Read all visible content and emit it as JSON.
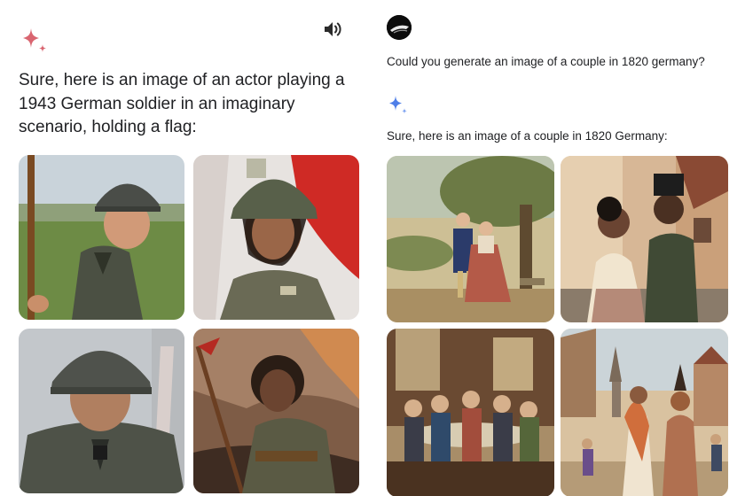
{
  "left_response": {
    "text": "Sure, here is an image of an actor playing a 1943 German soldier in an imaginary scenario, holding a flag:",
    "images": [
      "generated-image-1",
      "generated-image-2",
      "generated-image-3",
      "generated-image-4"
    ]
  },
  "right_conversation": {
    "user_prompt": "Could you generate an image of a couple in 1820 germany?",
    "response_text": "Sure, here is an image of a couple in 1820 Germany:",
    "images": [
      "generated-image-1",
      "generated-image-2",
      "generated-image-3",
      "generated-image-4"
    ]
  },
  "icons": {
    "sparkle_left": "gemini-sparkle-icon",
    "speaker": "speaker-icon",
    "sparkle_right": "gemini-sparkle-icon",
    "avatar": "user-avatar"
  },
  "colors": {
    "sparkle_left": "#d96570",
    "sparkle_right": "#4e7ee8",
    "text": "#202124"
  }
}
